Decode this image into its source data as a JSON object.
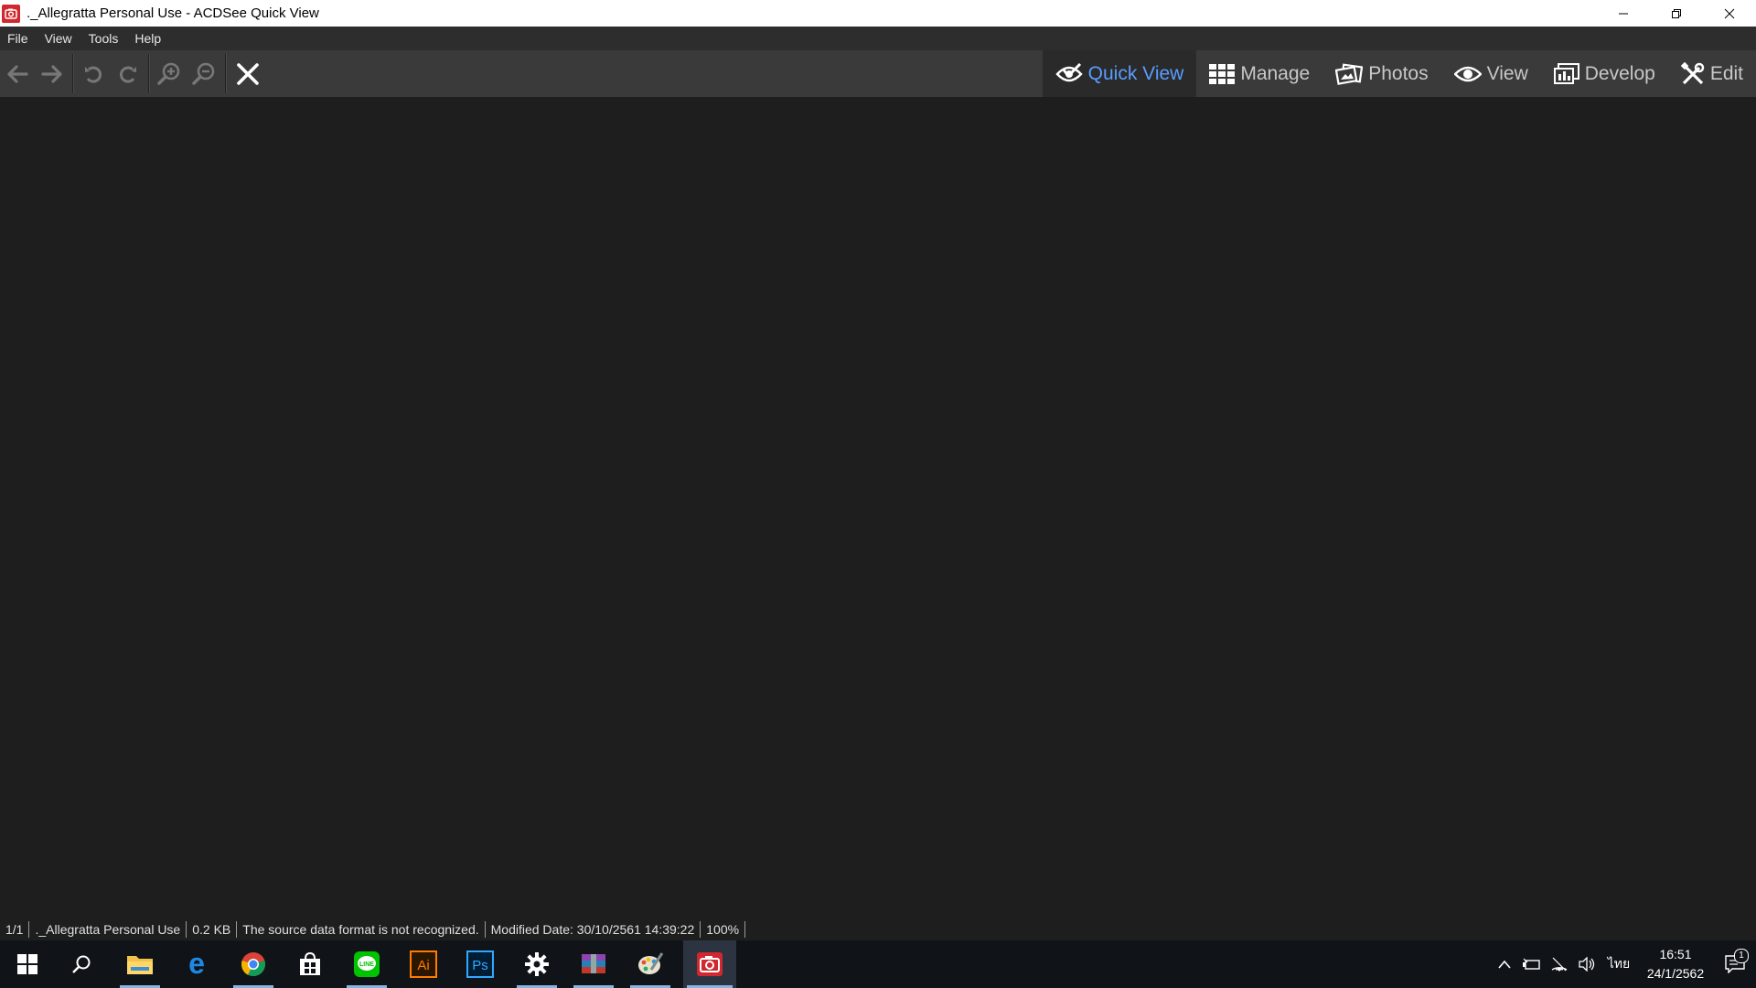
{
  "window": {
    "title": "._Allegratta Personal Use - ACDSee Quick View"
  },
  "menu": {
    "items": [
      {
        "label": "File"
      },
      {
        "label": "View"
      },
      {
        "label": "Tools"
      },
      {
        "label": "Help"
      }
    ]
  },
  "toolbar": {
    "modes": [
      {
        "label": "Quick View",
        "icon": "eye-check-icon",
        "active": true
      },
      {
        "label": "Manage",
        "icon": "grid-icon",
        "active": false
      },
      {
        "label": "Photos",
        "icon": "photos-icon",
        "active": false
      },
      {
        "label": "View",
        "icon": "eye-icon",
        "active": false
      },
      {
        "label": "Develop",
        "icon": "develop-icon",
        "active": false
      },
      {
        "label": "Edit",
        "icon": "tools-icon",
        "active": false
      }
    ]
  },
  "status": {
    "position": "1/1",
    "filename": "._Allegratta Personal Use",
    "size": "0.2 KB",
    "message": "The source data format is not recognized.",
    "modified": "Modified Date: 30/10/2561 14:39:22",
    "zoom": "100%"
  },
  "taskbar": {
    "language": "ไทย",
    "time": "16:51",
    "date": "24/1/2562",
    "notification_count": "1"
  },
  "colors": {
    "accent": "#5a9dff",
    "brand": "#d0282e",
    "viewer_bg": "#1e1e1e",
    "toolbar_bg": "#3a3a3a"
  }
}
